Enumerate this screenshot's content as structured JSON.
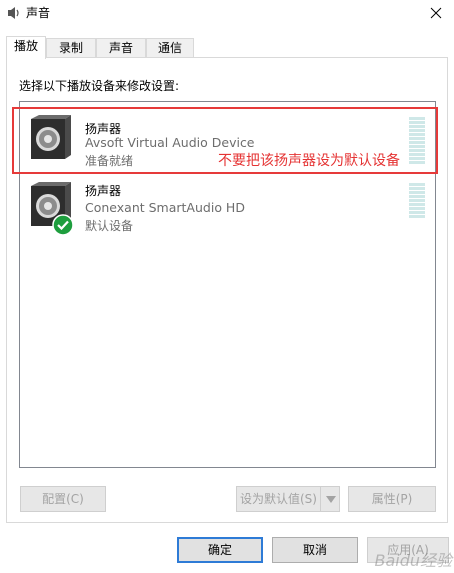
{
  "window": {
    "title": "声音",
    "icon": "speaker-icon",
    "close_icon": "close-icon"
  },
  "tabs": [
    {
      "label": "播放",
      "active": true
    },
    {
      "label": "录制",
      "active": false
    },
    {
      "label": "声音",
      "active": false
    },
    {
      "label": "通信",
      "active": false
    }
  ],
  "instruction": "选择以下播放设备来修改设置:",
  "devices": [
    {
      "name": "扬声器",
      "description": "Avsoft Virtual Audio Device",
      "status": "准备就绪",
      "is_default": false
    },
    {
      "name": "扬声器",
      "description": "Conexant SmartAudio HD",
      "status": "默认设备",
      "is_default": true
    }
  ],
  "annotation": "不要把该扬声器设为默认设备",
  "buttons": {
    "configure": "配置(C)",
    "set_default": "设为默认值(S)",
    "properties": "属性(P)",
    "ok": "确定",
    "cancel": "取消",
    "apply": "应用(A)"
  },
  "watermark": "Baidu经验",
  "colors": {
    "highlight": "#e63a3a",
    "annotation_text": "#e53333",
    "default_check": "#1e9e3e",
    "focus_border": "#2e7bd6"
  }
}
